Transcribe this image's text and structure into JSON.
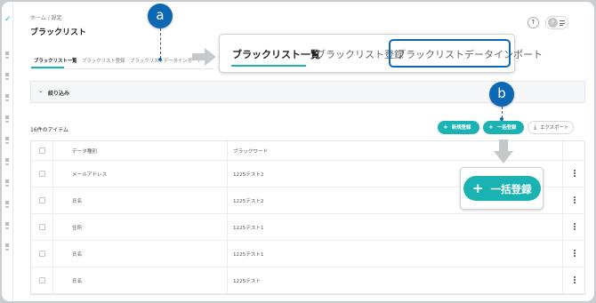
{
  "header": {
    "breadcrumb": "ホーム / 設定",
    "title": "ブラックリスト",
    "avatar_initial": "P"
  },
  "tabs": [
    {
      "label": "ブラックリスト一覧",
      "active": true
    },
    {
      "label": "ブラックリスト登録",
      "active": false
    },
    {
      "label": "ブラックリストデータインポート",
      "active": false
    }
  ],
  "filter": {
    "label": "絞り込み"
  },
  "toolbar": {
    "count_label": "16件のアイテム",
    "new_label": "新規登録",
    "bulk_label": "一括登録",
    "export_label": "エクスポート"
  },
  "table": {
    "columns": [
      "データ種別",
      "ブラックワード"
    ],
    "rows": [
      [
        "メールアドレス",
        "1225テスト2"
      ],
      [
        "氏名",
        "1225テスト2"
      ],
      [
        "住所",
        "1225テスト1"
      ],
      [
        "氏名",
        "1225テスト1"
      ],
      [
        "氏名",
        "1225テスト"
      ]
    ]
  },
  "annotations": {
    "marker_a": "a",
    "marker_b": "b",
    "zoom_tabs": [
      "ブラックリスト一覧",
      "ブラックリスト登録",
      "ブラックリストデータインポート"
    ],
    "zoom_button_label": "一括登録"
  },
  "colors": {
    "accent": "#1ab2b2",
    "marker": "#0d68b4"
  }
}
